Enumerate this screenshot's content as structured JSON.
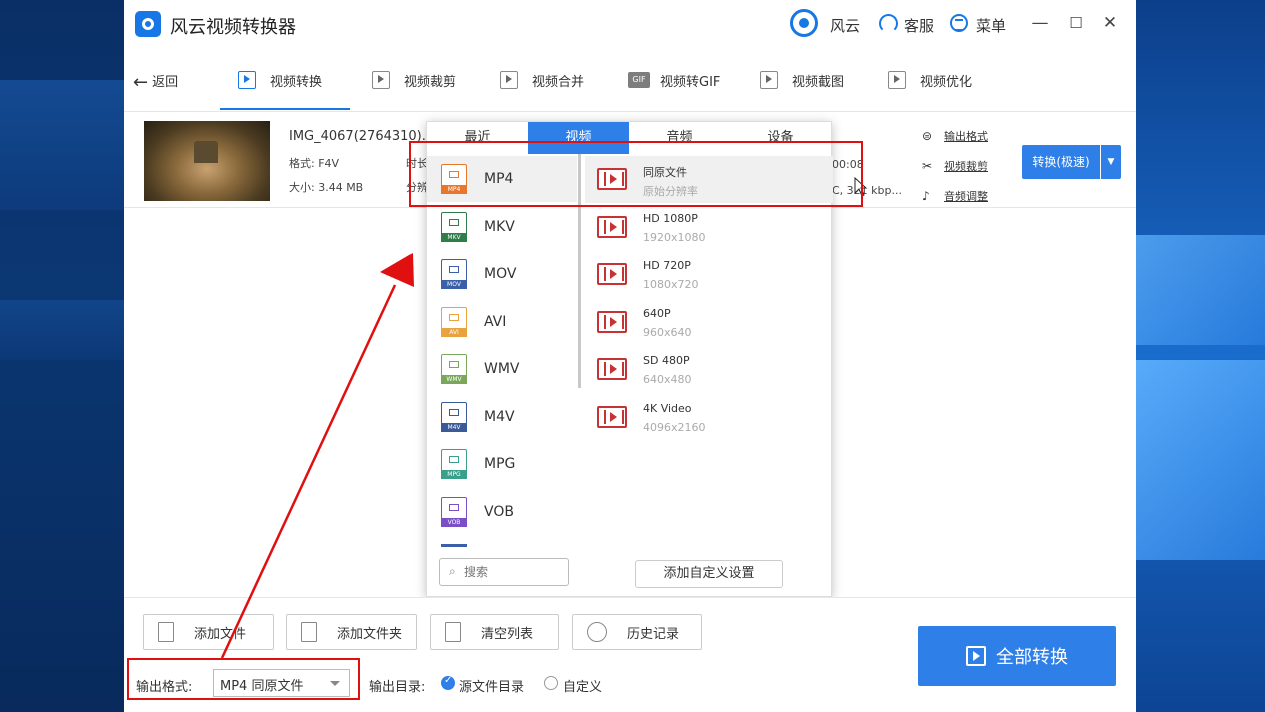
{
  "app": {
    "title": "风云视频转换器"
  },
  "titlebar": {
    "user_label": "风云",
    "service_label": "客服",
    "menu_label": "菜单",
    "minimize": "—",
    "maximize": "☐",
    "close": "✕"
  },
  "toolbar": {
    "back_label": "返回",
    "tabs": [
      {
        "label": "视频转换"
      },
      {
        "label": "视频裁剪"
      },
      {
        "label": "视频合并"
      },
      {
        "label": "视频转GIF",
        "icon_text": "GIF"
      },
      {
        "label": "视频截图"
      },
      {
        "label": "视频优化"
      }
    ]
  },
  "file": {
    "name": "IMG_4067(2764310).f",
    "format": "格式: F4V",
    "size": "大小: 3.44 MB",
    "duration_trunc": "时长",
    "resolution_trunc": "分辨",
    "duration_tail": "00:08",
    "bitrate_tail": "C, 321 kbp...",
    "links": {
      "output_format": "输出格式",
      "video_trim": "视频裁剪",
      "audio_adjust": "音频调整"
    },
    "convert_label": "转换(极速)"
  },
  "dropdown": {
    "tabs": [
      {
        "label": "最近"
      },
      {
        "label": "视频"
      },
      {
        "label": "音频"
      },
      {
        "label": "设备"
      }
    ],
    "formats": [
      {
        "label": "MP4",
        "tag": "MP4",
        "color": "#e8772e"
      },
      {
        "label": "MKV",
        "tag": "MKV",
        "color": "#2f7d4a"
      },
      {
        "label": "MOV",
        "tag": "MOV",
        "color": "#3b5fa8"
      },
      {
        "label": "AVI",
        "tag": "AVI",
        "color": "#e8a23e"
      },
      {
        "label": "WMV",
        "tag": "WMV",
        "color": "#7aa85a"
      },
      {
        "label": "M4V",
        "tag": "M4V",
        "color": "#3a5a98"
      },
      {
        "label": "MPG",
        "tag": "MPG",
        "color": "#3aa08c"
      },
      {
        "label": "VOB",
        "tag": "VOB",
        "color": "#7a4fc8"
      }
    ],
    "resolutions": [
      {
        "name": "同原文件",
        "sub": "原始分辨率"
      },
      {
        "name": "HD 1080P",
        "sub": "1920x1080"
      },
      {
        "name": "HD 720P",
        "sub": "1080x720"
      },
      {
        "name": "640P",
        "sub": "960x640"
      },
      {
        "name": "SD 480P",
        "sub": "640x480"
      },
      {
        "name": "4K Video",
        "sub": "4096x2160"
      }
    ],
    "search_placeholder": "搜索",
    "add_custom_label": "添加自定义设置"
  },
  "bottom": {
    "add_file": "添加文件",
    "add_folder": "添加文件夹",
    "clear_list": "清空列表",
    "history": "历史记录",
    "output_format_label": "输出格式:",
    "output_format_value": "MP4 同原文件",
    "output_dir_label": "输出目录:",
    "dir_option_source": "源文件目录",
    "dir_option_custom": "自定义",
    "convert_all": "全部转换"
  },
  "colors": {
    "accent": "#2e7fe8",
    "annotation": "#e01010"
  }
}
